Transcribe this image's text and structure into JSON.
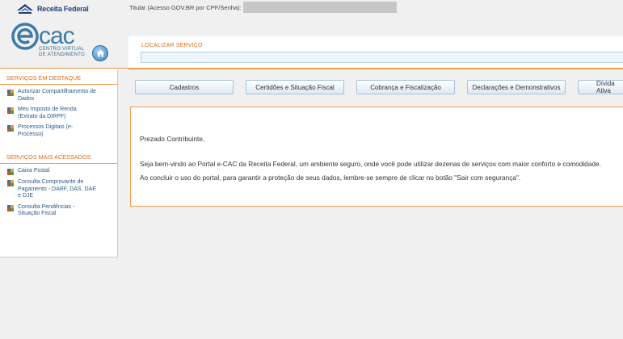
{
  "header": {
    "brand": "Receita Federal",
    "titular_label": "Titular (Acesso GOV.BR por CPF/Senha):",
    "ecac_letters": "cac",
    "ecac_sub_line1": "CENTRO VIRTUAL",
    "ecac_sub_line2": "DE ATENDIMENTO"
  },
  "search": {
    "label": "LOCALIZAR SERVIÇO",
    "value": "",
    "placeholder": ""
  },
  "sidebar": {
    "destaque_title": "SERVIÇOS EM DESTAQUE",
    "destaque_items": [
      {
        "line1": "Autorizar Compartilhamento de",
        "line2": "Dados"
      },
      {
        "line1": "Meu Imposto de Renda",
        "line2": "(Extrato da DIRPF)"
      },
      {
        "line1": "Processos Digitais (e-",
        "line2": "Processo)"
      }
    ],
    "acessados_title": "SERVIÇOS MAIS ACESSADOS",
    "acessados_items": [
      {
        "line1": "Caixa Postal",
        "line2": "",
        "line3": ""
      },
      {
        "line1": "Consulta Comprovante de",
        "line2": "Pagamento - DARF, DAS, DAE",
        "line3": "e DJE"
      },
      {
        "line1": "Consulta Pendências -",
        "line2": "Situação Fiscal",
        "line3": ""
      }
    ]
  },
  "tabs": [
    {
      "label": "Cadastros"
    },
    {
      "label": "Certidões e Situação Fiscal"
    },
    {
      "label": "Cobrança e Fiscalização"
    },
    {
      "label": "Declarações e Demonstrativos"
    },
    {
      "label": "Dívida Ativa"
    }
  ],
  "content": {
    "greeting": "Prezado Contribuinte,",
    "para1": "Seja bem-vindo ao Portal e-CAC da Receita Federal, um ambiente seguro, onde você pode utilizar dezenas de serviços com maior conforto e comodidade.",
    "para2": "Ao concluir o uso do portal, para garantir a proteção de seus dados, lembre-se sempre de clicar no botão \"Sair com segurança\"."
  },
  "colors": {
    "accent_orange": "#e26b1a",
    "link_blue": "#2a5a8a",
    "brand_blue": "#3d7aa6"
  },
  "icons": {
    "brand": "receita-emblem-icon",
    "home": "home-icon",
    "bullet": "puzzle-bullet-icon"
  }
}
